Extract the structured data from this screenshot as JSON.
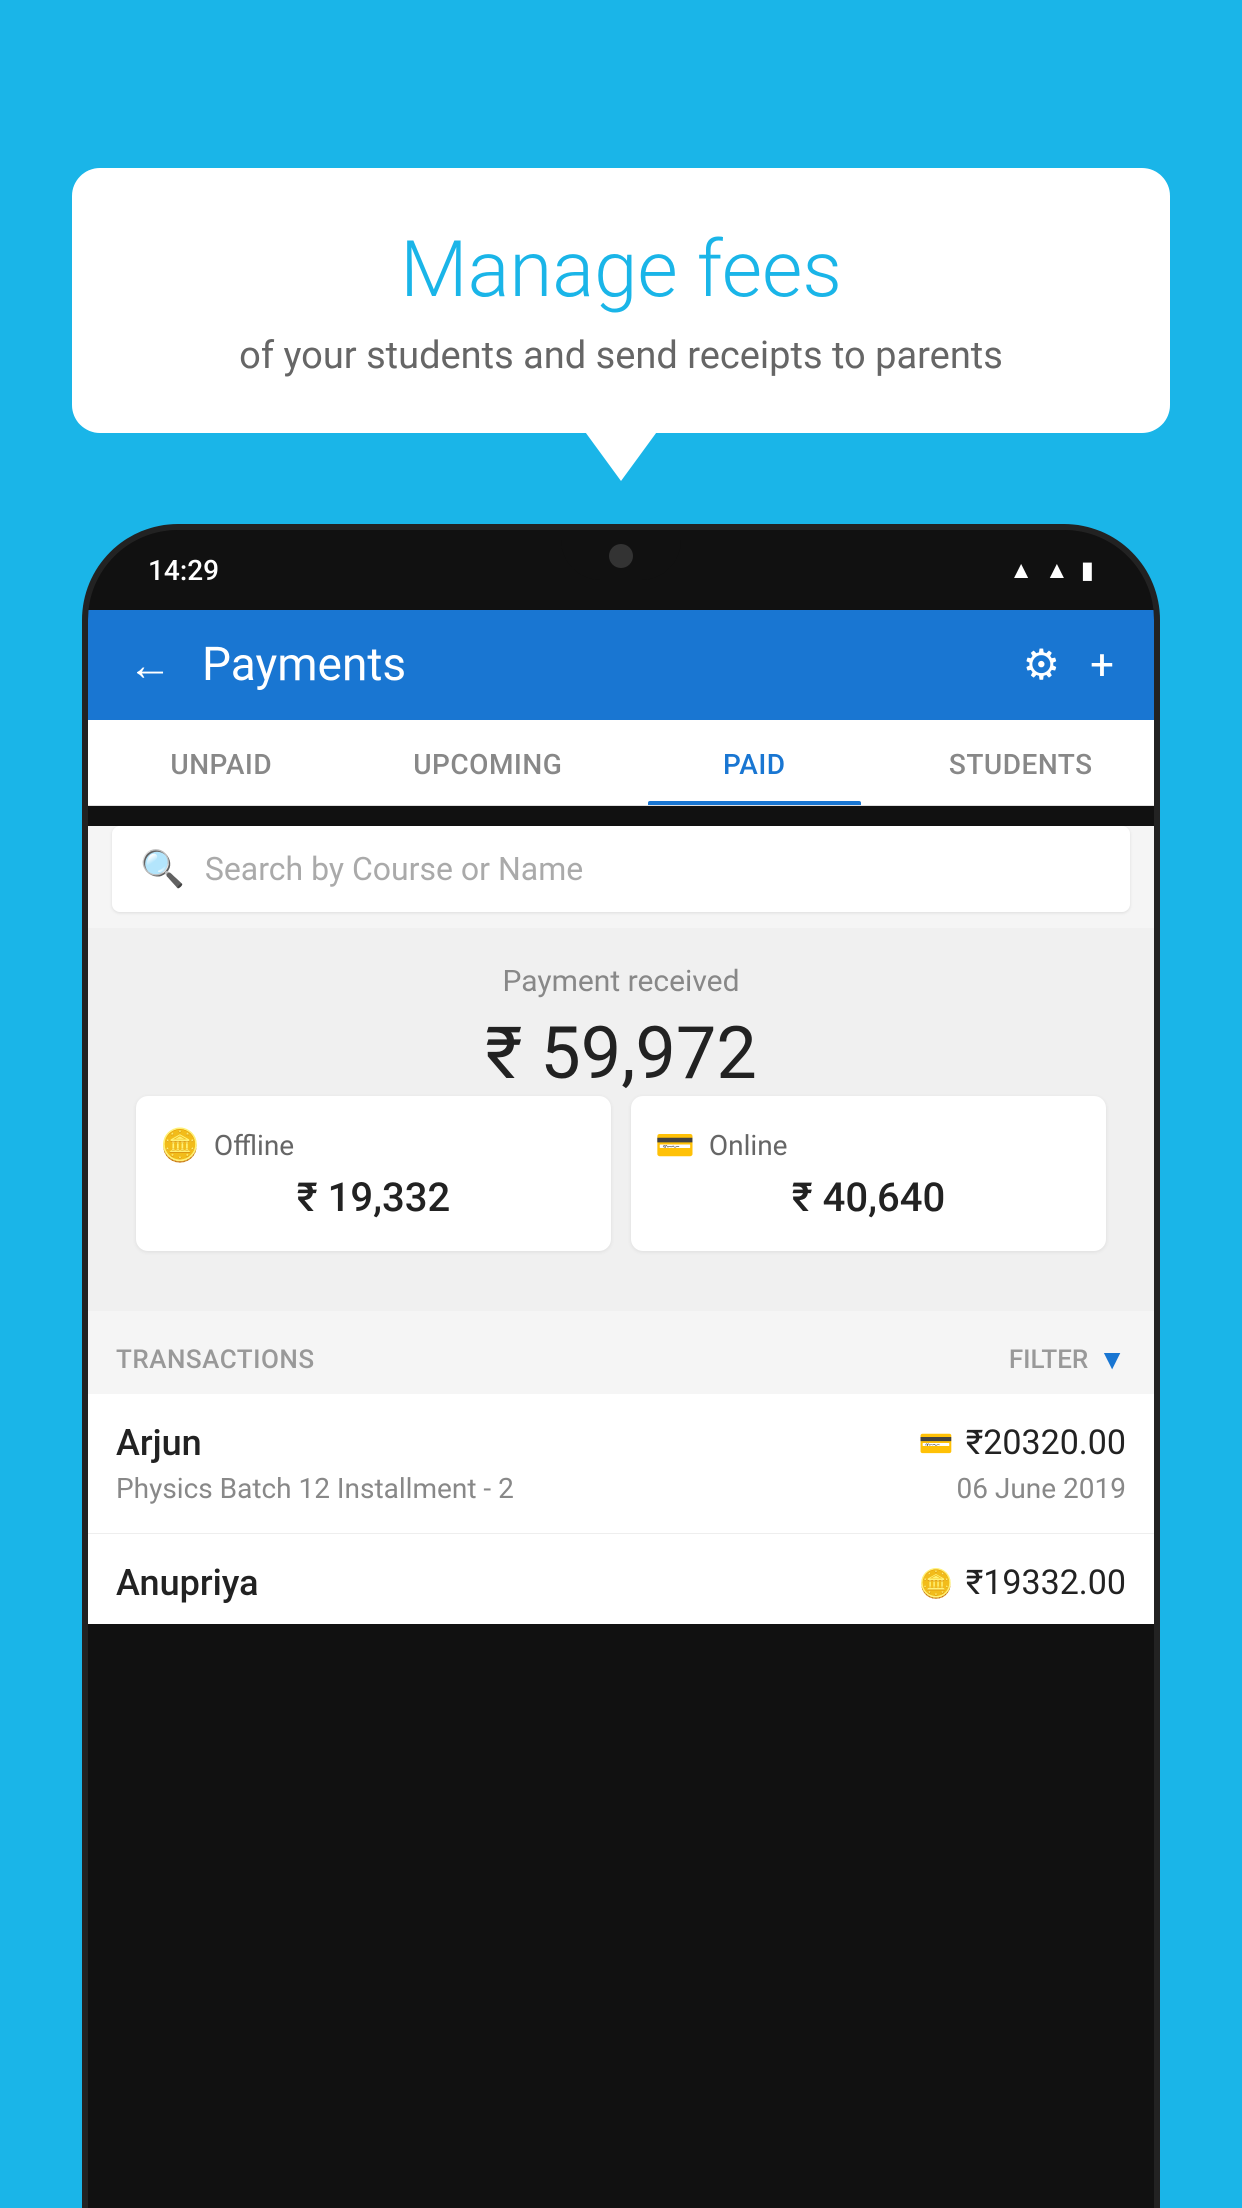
{
  "page": {
    "bg_color": "#1ab5e8"
  },
  "bubble": {
    "title": "Manage fees",
    "subtitle": "of your students and send receipts to parents"
  },
  "status_bar": {
    "time": "14:29",
    "icons": [
      "wifi",
      "signal",
      "battery"
    ]
  },
  "app_bar": {
    "back_icon": "←",
    "title": "Payments",
    "settings_icon": "⚙",
    "add_icon": "+"
  },
  "tabs": [
    {
      "label": "UNPAID",
      "active": false
    },
    {
      "label": "UPCOMING",
      "active": false
    },
    {
      "label": "PAID",
      "active": true
    },
    {
      "label": "STUDENTS",
      "active": false
    }
  ],
  "search": {
    "placeholder": "Search by Course or Name"
  },
  "payment_received": {
    "label": "Payment received",
    "amount": "₹ 59,972"
  },
  "payment_methods": [
    {
      "icon": "💳",
      "label": "Offline",
      "amount": "₹ 19,332"
    },
    {
      "icon": "💳",
      "label": "Online",
      "amount": "₹ 40,640"
    }
  ],
  "transactions_section": {
    "label": "TRANSACTIONS",
    "filter_label": "FILTER"
  },
  "transactions": [
    {
      "name": "Arjun",
      "course": "Physics Batch 12 Installment - 2",
      "amount": "₹20320.00",
      "date": "06 June 2019",
      "payment_type": "card"
    },
    {
      "name": "Anupriya",
      "course": "",
      "amount": "₹19332.00",
      "date": "",
      "payment_type": "offline"
    }
  ]
}
